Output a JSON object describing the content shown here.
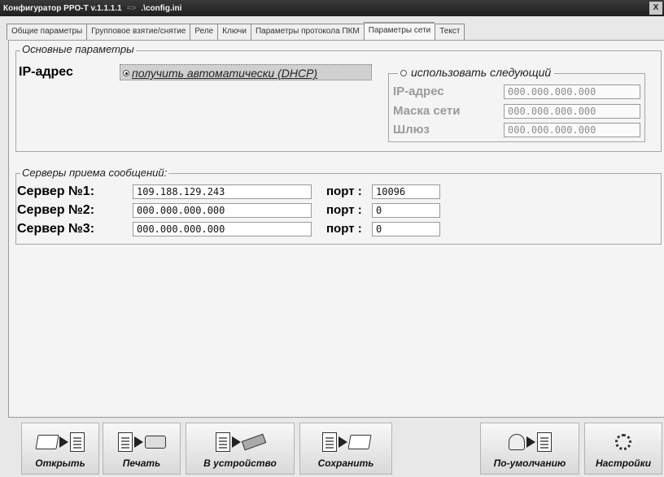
{
  "window": {
    "title": "Конфигуратор PPO-T v.1.1.1.1",
    "arrow": "=>",
    "path": ".\\config.ini",
    "close_label": "X"
  },
  "tabs": [
    {
      "label": "Общие параметры"
    },
    {
      "label": "Групповое взятие/снятие"
    },
    {
      "label": "Реле"
    },
    {
      "label": "Ключи"
    },
    {
      "label": "Параметры протокола ПКМ"
    },
    {
      "label": "Параметры сети"
    },
    {
      "label": "Текст"
    }
  ],
  "active_tab_index": 5,
  "basic": {
    "legend": "Основные параметры",
    "ip_label": "IP-адрес",
    "dhcp_option": "получить автоматически (DHCP)",
    "manual_option": "использовать следующий",
    "ip_field_label": "IP-адрес",
    "ip_value": "000.000.000.000",
    "mask_label": "Маска сети",
    "mask_value": "000.000.000.000",
    "gateway_label": "Шлюз",
    "gateway_value": "000.000.000.000"
  },
  "servers": {
    "legend": "Серверы приема сообщений:",
    "port_label": "порт :",
    "rows": [
      {
        "label": "Сервер №1:",
        "address": "109.188.129.243",
        "port": "10096"
      },
      {
        "label": "Сервер №2:",
        "address": "000.000.000.000",
        "port": "0"
      },
      {
        "label": "Сервер №3:",
        "address": "000.000.000.000",
        "port": "0"
      }
    ]
  },
  "toolbar": {
    "open": "Открыть",
    "print": "Печать",
    "to_device": "В устройство",
    "save": "Сохранить",
    "defaults": "По-умолчанию",
    "settings": "Настройки"
  }
}
